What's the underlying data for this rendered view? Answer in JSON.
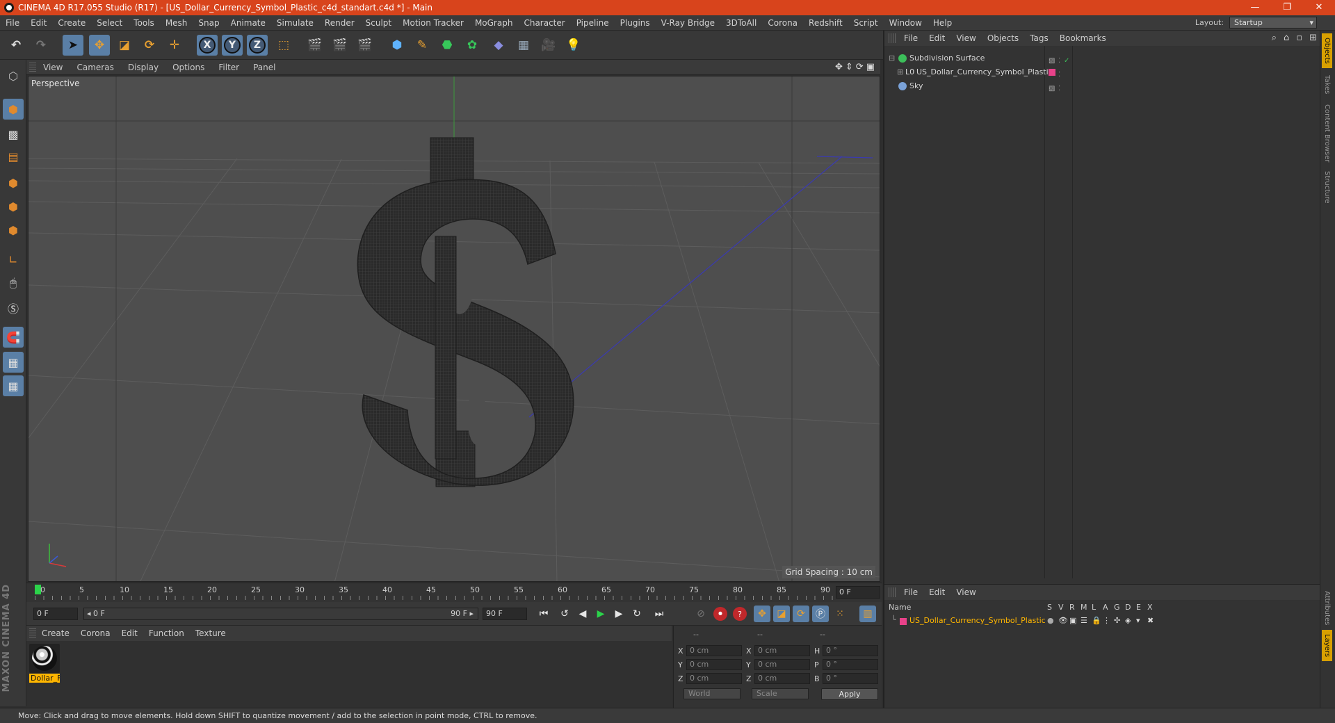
{
  "title": {
    "text": "CINEMA 4D R17.055 Studio (R17) - [US_Dollar_Currency_Symbol_Plastic_c4d_standart.c4d *] - Main",
    "controls": [
      "—",
      "❐",
      "✕"
    ]
  },
  "menu": [
    "File",
    "Edit",
    "Create",
    "Select",
    "Tools",
    "Mesh",
    "Snap",
    "Animate",
    "Simulate",
    "Render",
    "Sculpt",
    "Motion Tracker",
    "MoGraph",
    "Character",
    "Pipeline",
    "Plugins",
    "V-Ray Bridge",
    "3DToAll",
    "Corona",
    "Redshift",
    "Script",
    "Window",
    "Help"
  ],
  "layout": {
    "label": "Layout:",
    "value": "Startup"
  },
  "toolbar": {
    "axis_x": "X",
    "axis_y": "Y",
    "axis_z": "Z",
    "icons": [
      "undo-icon",
      "redo-icon",
      "select-icon",
      "move-icon",
      "scale-icon",
      "rotate-icon",
      "live-select-icon",
      "x-axis-icon",
      "y-axis-icon",
      "z-axis-icon",
      "coordinate-system-icon",
      "render-view-icon",
      "render-picture-viewer-icon",
      "edit-render-settings-icon",
      "cube-icon",
      "pen-icon",
      "subdivision-icon",
      "array-icon",
      "deformer-icon",
      "floor-icon",
      "camera-icon",
      "light-icon"
    ]
  },
  "viewport": {
    "menu": [
      "View",
      "Cameras",
      "Display",
      "Options",
      "Filter",
      "Panel"
    ],
    "label": "Perspective",
    "grid_spacing": "Grid Spacing : 10 cm",
    "nav_icons": [
      "✥",
      "⇕",
      "⟳",
      "▣"
    ]
  },
  "timeline": {
    "ticks": [
      "0",
      "5",
      "10",
      "15",
      "20",
      "25",
      "30",
      "35",
      "40",
      "45",
      "50",
      "55",
      "60",
      "65",
      "70",
      "75",
      "80",
      "85",
      "90"
    ],
    "current_frame": "0 F"
  },
  "transport": {
    "start": "0 F",
    "range_start": "◂ 0 F",
    "range_end": "90 F ▸",
    "end": "90 F"
  },
  "materials": {
    "menu": [
      "Create",
      "Corona",
      "Edit",
      "Function",
      "Texture"
    ],
    "items": [
      {
        "name": "Dollar_F"
      }
    ]
  },
  "coords": {
    "headers": [
      "--",
      "--",
      "--"
    ],
    "rows": [
      {
        "a": "X",
        "av": "0 cm",
        "b": "X",
        "bv": "0 cm",
        "c": "H",
        "cv": "0 °"
      },
      {
        "a": "Y",
        "av": "0 cm",
        "b": "Y",
        "bv": "0 cm",
        "c": "P",
        "cv": "0 °"
      },
      {
        "a": "Z",
        "av": "0 cm",
        "b": "Z",
        "bv": "0 cm",
        "c": "B",
        "cv": "0 °"
      }
    ],
    "mode1": "World",
    "mode2": "Scale",
    "apply": "Apply"
  },
  "status": "Move: Click and drag to move elements. Hold down SHIFT to quantize movement / add to the selection in point mode, CTRL to remove.",
  "objects": {
    "menu": [
      "File",
      "Edit",
      "View",
      "Objects",
      "Tags",
      "Bookmarks"
    ],
    "items": [
      {
        "name": "Subdivision Surface",
        "color": "#3cbf5a"
      },
      {
        "name": "US_Dollar_Currency_Symbol_Plastic",
        "color": "#cfcfcf"
      },
      {
        "name": "Sky",
        "color": "#7aa2d8"
      }
    ]
  },
  "right_tabs": [
    "Objects",
    "Takes",
    "Content Browser",
    "Structure",
    "Attributes",
    "Layers"
  ],
  "layers": {
    "menu": [
      "File",
      "Edit",
      "View"
    ],
    "columns": [
      "Name",
      "S",
      "V",
      "R",
      "M",
      "L",
      "A",
      "G",
      "D",
      "E",
      "X"
    ],
    "items": [
      {
        "name": "US_Dollar_Currency_Symbol_Plastic",
        "color": "#e8428a"
      }
    ]
  },
  "maxon_logo": "MAXON CINEMA 4D"
}
